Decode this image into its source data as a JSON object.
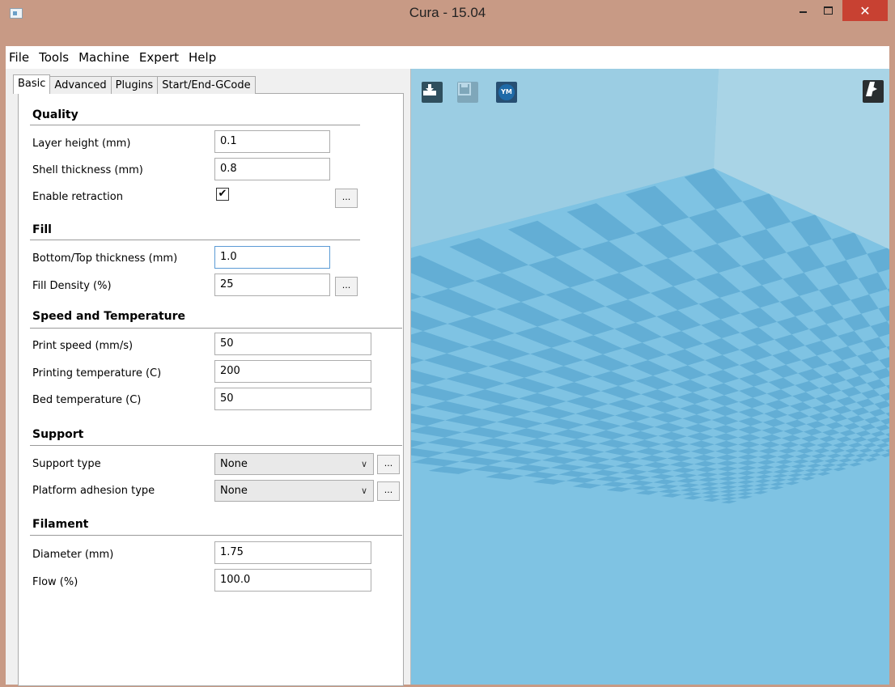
{
  "window": {
    "title": "Cura - 15.04",
    "close_glyph": "✕"
  },
  "menu": [
    "File",
    "Tools",
    "Machine",
    "Expert",
    "Help"
  ],
  "tabs": [
    "Basic",
    "Advanced",
    "Plugins",
    "Start/End-GCode"
  ],
  "active_tab": "Basic",
  "sections": {
    "quality": {
      "title": "Quality",
      "layer_height": {
        "label": "Layer height (mm)",
        "value": "0.1"
      },
      "shell_thickness": {
        "label": "Shell thickness (mm)",
        "value": "0.8"
      },
      "enable_retraction": {
        "label": "Enable retraction",
        "checked": true,
        "check_glyph": "✔"
      }
    },
    "fill": {
      "title": "Fill",
      "bottom_top_thickness": {
        "label": "Bottom/Top thickness (mm)",
        "value": "1.0"
      },
      "fill_density": {
        "label": "Fill Density (%)",
        "value": "25"
      }
    },
    "speed": {
      "title": "Speed and Temperature",
      "print_speed": {
        "label": "Print speed (mm/s)",
        "value": "50"
      },
      "printing_temperature": {
        "label": "Printing temperature (C)",
        "value": "200"
      },
      "bed_temperature": {
        "label": "Bed temperature (C)",
        "value": "50"
      }
    },
    "support": {
      "title": "Support",
      "support_type": {
        "label": "Support type",
        "value": "None"
      },
      "platform_adhesion": {
        "label": "Platform adhesion type",
        "value": "None"
      }
    },
    "filament": {
      "title": "Filament",
      "diameter": {
        "label": "Diameter (mm)",
        "value": "1.75"
      },
      "flow": {
        "label": "Flow (%)",
        "value": "100.0"
      }
    }
  },
  "ellipsis_label": "...",
  "viewport": {
    "toolbar": {
      "load": "load-icon",
      "save": "save-icon",
      "ym": "YM",
      "view_mode": "view-mode-icon"
    },
    "colors": {
      "floor_light": "#7fc3e3",
      "floor_dark": "#63aed5",
      "wall_back": "#9bcde3",
      "wall_right": "#a9d4e6"
    }
  }
}
